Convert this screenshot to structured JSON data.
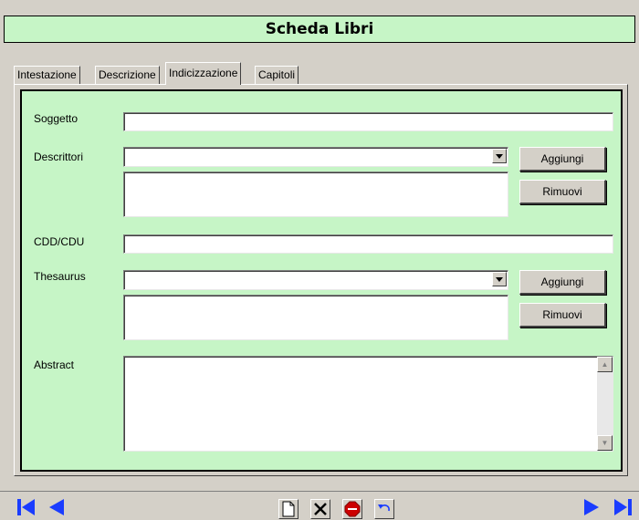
{
  "window": {
    "title": "Scheda Libri"
  },
  "tabs": [
    {
      "label": "Intestazione",
      "active": false
    },
    {
      "label": "Descrizione",
      "active": false
    },
    {
      "label": "Indicizzazione",
      "active": true
    },
    {
      "label": "Capitoli",
      "active": false
    }
  ],
  "form": {
    "soggetto": {
      "label": "Soggetto",
      "value": ""
    },
    "descrittori": {
      "label": "Descrittori",
      "value": "",
      "list_items": [],
      "add_label": "Aggiungi",
      "remove_label": "Rimuovi"
    },
    "cdd": {
      "label": "CDD/CDU",
      "value": ""
    },
    "thesaurus": {
      "label": "Thesaurus",
      "value": "",
      "list_items": [],
      "add_label": "Aggiungi",
      "remove_label": "Rimuovi"
    },
    "abstract": {
      "label": "Abstract",
      "value": ""
    }
  },
  "toolbar": {
    "icons": [
      "first-record-icon",
      "previous-record-icon",
      "new-record-icon",
      "delete-record-icon",
      "stop-icon",
      "undo-icon",
      "next-record-icon",
      "last-record-icon"
    ]
  },
  "colors": {
    "form_background": "#c6f5c6",
    "title_background": "#c6f5c6",
    "window_background": "#d4d0c8",
    "nav_arrow": "#1a3cff"
  }
}
